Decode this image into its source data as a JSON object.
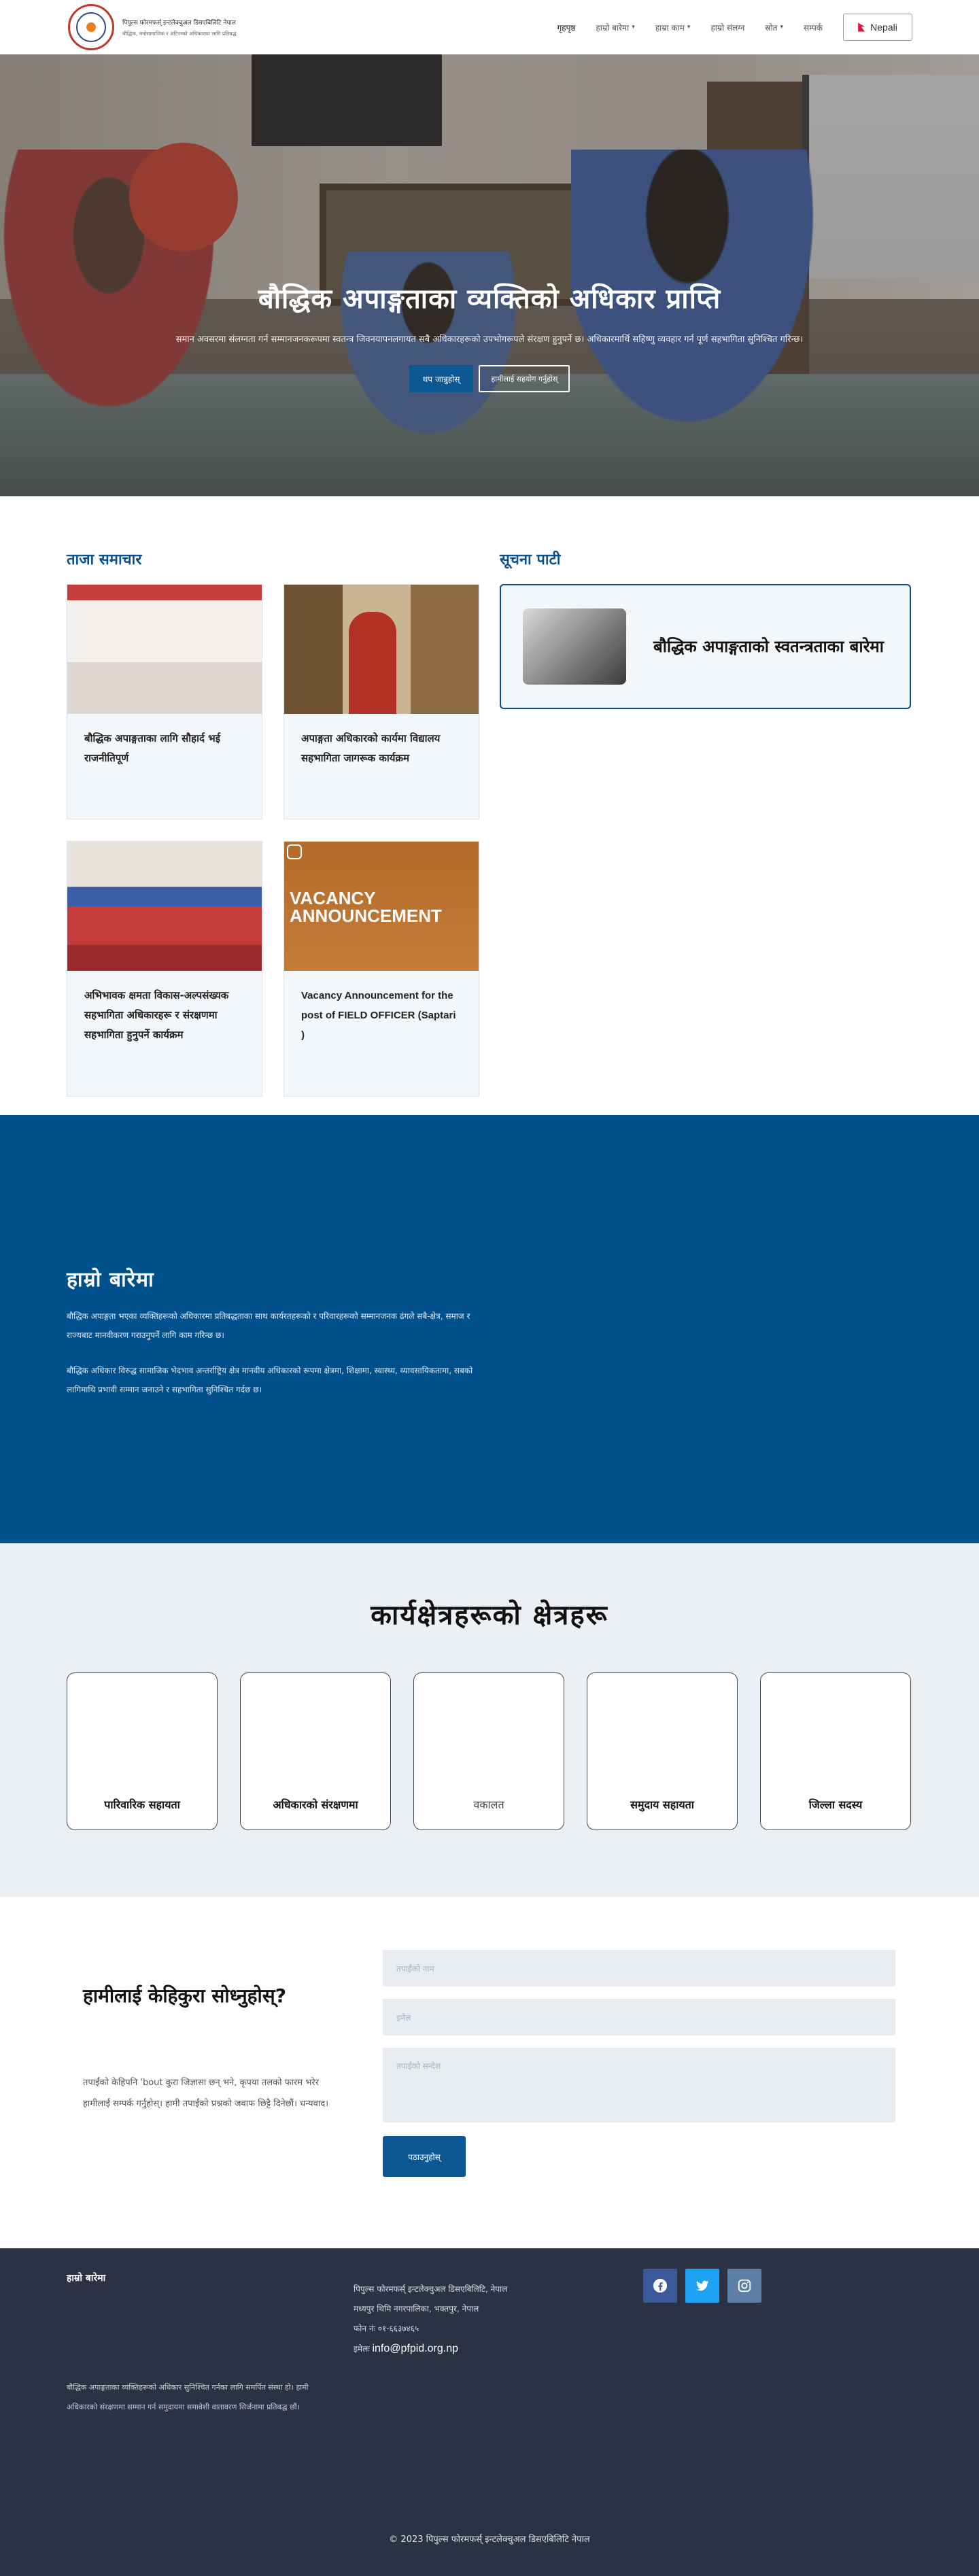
{
  "header": {
    "org_title": "पिपुल्स फोरमफर्स् इन्टलेक्चुअल डिसएबिलिटि नेपाल",
    "org_sub": "बौद्धिक, मनोसामाजिक र अटिज्म्को अधिकारका लागि प्रतिबद्ध",
    "nav": [
      {
        "label": "गृहपृष्ठ",
        "caret": false
      },
      {
        "label": "हाम्रो बारेमा",
        "caret": true
      },
      {
        "label": "हाम्रा काम",
        "caret": true
      },
      {
        "label": "हाम्रो संलग्न",
        "caret": false
      },
      {
        "label": "स्रोत",
        "caret": true
      },
      {
        "label": "सम्पर्क",
        "caret": false
      }
    ],
    "lang_label": "Nepali"
  },
  "hero": {
    "title": "बौद्धिक अपाङ्गताका व्यक्तिको अधिकार प्राप्ति",
    "subtitle": "समान अवसरमा संलग्नता गर्न सम्मानजनकरूपमा स्वतन्त्र जिवनयापनलगायत सबै अधिकारहरूको उपभोगरूपले संरक्षण हुनुपर्ने छ। अधिकारमार्थि सहिष्णु व्यवहार गर्न पूर्ण सहभागिता सुनिश्चित गरिन्छ।",
    "btn_primary": "थप जान्नुहोस्",
    "btn_outline": "हामीलाई सहयोग गर्नुहोस्"
  },
  "news": {
    "heading": "ताजा समाचार",
    "cards": [
      {
        "title": "बौद्धिक अपाङ्गताका लागि सौहार्द भई राजनीतिपूर्ण",
        "latin": false
      },
      {
        "title": "अपाङ्गता अधिकारको कार्यमा विद्यालय सहभागिता जागरूक कार्यक्रम",
        "latin": false
      },
      {
        "title": "अभिभावक क्षमता विकास-अल्पसंख्यक सहभागिता अधिकारहरू र संरक्षणमा सहभागिता हुनुपर्ने कार्यक्रम",
        "latin": false
      },
      {
        "title": "Vacancy Announcement for the post of FIELD OFFICER (Saptari )",
        "latin": true
      }
    ],
    "vacancy_img_text": "VACANCY ANNOUNCEMENT"
  },
  "notices": {
    "heading": "सूचना पाटी",
    "item_title": "बौद्धिक अपाङ्गताको स्वतन्त्रताका बारेमा"
  },
  "about": {
    "heading": "हाम्रो बारेमा",
    "para1": "बौद्धिक अपाङ्गता भएका व्यक्तिहरूको अधिकारमा प्रतिबद्धताका साथ कार्यरतहरूको र परिवारहरूको सम्मानजनक ढंगले सबै-क्षेत्र, समाज र राज्यबाट मानवीकरण गराउनुपर्ने लागि काम गरिन्छ छ।",
    "para2": "बौद्धिक अधिकार विरुद्ध सामाजिक भेदभाव अन्तर्राष्ट्रिय क्षेत्र मानवीय अधिकारको रूपमा क्षेत्रमा, शिक्षामा, स्वास्थ्य, व्यावसायिकतामा, सबको लागिमाथि प्रभावी सम्मान जनाउने र सहभागिता सुनिश्चित गर्दछ छ।"
  },
  "areas": {
    "heading": "कार्यक्षेत्रहरूको क्षेत्रहरू",
    "items": [
      "पारिवारिक सहायता",
      "अधिकारको संरक्षणमा",
      "वकालत",
      "समुदाय सहायता",
      "जिल्ला सदस्य"
    ]
  },
  "contact": {
    "heading": "हामीलाई केहिकुरा सोध्नुहोस्?",
    "text": "तपाईंको केहिपनि 'bout कुरा जिज्ञासा छन् भने, कृपया तलको फारम भरेर हामीलाई सम्पर्क गर्नुहोस्। हामी तपाईंको प्रश्नको जवाफ छिट्टै दिनेछौं। धन्यवाद।",
    "name_placeholder": "तपाईंको नाम",
    "email_placeholder": "इमेल",
    "message_placeholder": "तपाईंको सन्देश",
    "send_label": "पठाउनुहोस्"
  },
  "footer": {
    "heading": "हाम्रो बारेमा",
    "about": "बौद्धिक अपाङ्गताका व्यक्तिहरूको अधिकार सुनिश्चित गर्नका लागि समर्पित संस्था हो। हामी अधिकारको संरक्षणमा सम्मान गर्न समुदायमा समावेशी वातावरण सिर्जनामा प्रतिबद्ध छौं।",
    "address_lines": [
      "पिपुल्स फोरमफर्स् इन्टलेक्चुअल डिसएबिलिटि, नेपाल",
      "मध्यपुर थिमि नगरपालिका, भक्तपुर, नेपाल",
      "फोन नंः ०१-६६३७४६५"
    ],
    "email_label": "इमेलः",
    "email": "info@pfpid.org.np",
    "copyright": "© 2023 पिपुल्स फोरमफर्स् इन्टलेक्चुअल डिसएबिलिटि नेपाल"
  }
}
